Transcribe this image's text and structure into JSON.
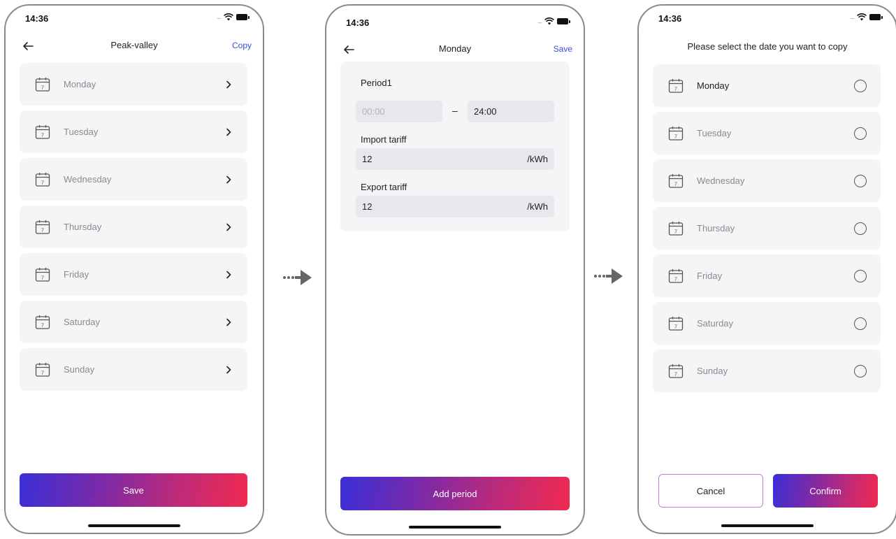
{
  "status": {
    "time": "14:36",
    "signal": "....."
  },
  "screen1": {
    "title": "Peak-valley",
    "action": "Copy",
    "days": [
      {
        "label": "Monday",
        "calendar_day": "7"
      },
      {
        "label": "Tuesday",
        "calendar_day": "7"
      },
      {
        "label": "Wednesday",
        "calendar_day": "7"
      },
      {
        "label": "Thursday",
        "calendar_day": "7"
      },
      {
        "label": "Friday",
        "calendar_day": "7"
      },
      {
        "label": "Saturday",
        "calendar_day": "7"
      },
      {
        "label": "Sunday",
        "calendar_day": "7"
      }
    ],
    "save_label": "Save"
  },
  "screen2": {
    "title": "Monday",
    "action": "Save",
    "period_label": "Period1",
    "start_time_placeholder": "00:00",
    "time_separator": "–",
    "end_time": "24:00",
    "import_label": "Import tariff",
    "import_value": "12",
    "import_unit": "/kWh",
    "export_label": "Export tariff",
    "export_value": "12",
    "export_unit": "/kWh",
    "add_period_label": "Add period"
  },
  "screen3": {
    "prompt": "Please select the date you want to copy",
    "days": [
      {
        "label": "Monday",
        "selected": false,
        "emphasized": true
      },
      {
        "label": "Tuesday",
        "selected": false
      },
      {
        "label": "Wednesday",
        "selected": false
      },
      {
        "label": "Thursday",
        "selected": false
      },
      {
        "label": "Friday",
        "selected": false
      },
      {
        "label": "Saturday",
        "selected": false
      },
      {
        "label": "Sunday",
        "selected": false
      }
    ],
    "cancel_label": "Cancel",
    "confirm_label": "Confirm"
  },
  "colors": {
    "accent_link": "#3a4fd8",
    "gradient_start": "#3a2fd8",
    "gradient_end": "#f02a50",
    "card_bg": "#f4f5f7",
    "cancel_border": "#c27fd4"
  },
  "icons": {
    "back": "arrow-left-icon",
    "calendar": "calendar-icon",
    "chevron": "chevron-right-icon",
    "radio": "radio-unchecked-icon",
    "flow": "flow-arrow-icon"
  }
}
